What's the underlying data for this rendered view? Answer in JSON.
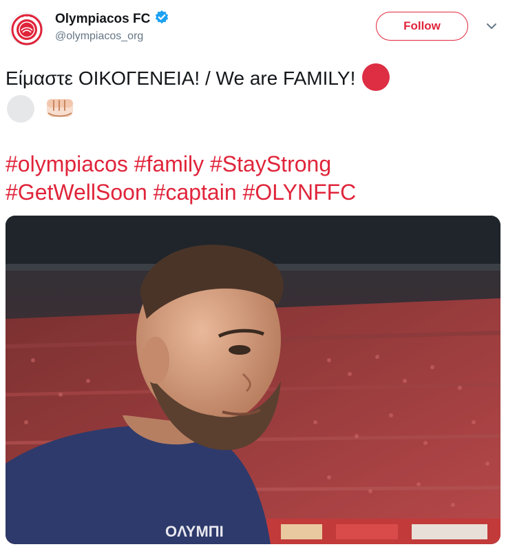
{
  "account": {
    "name": "Olympiacos FC",
    "handle": "@olympiacos_org",
    "avatar_icon": "olympiacos-crest",
    "verified_icon": "verified-badge-icon"
  },
  "follow_button": {
    "label": "Follow"
  },
  "more_icon": "chevron-down-icon",
  "tweet": {
    "line1": "Είμαστε ΟΙΚΟΓΕΝΕΙΑ! / We are FAMILY!",
    "emoji": [
      "red-circle",
      "white-circle",
      "fist"
    ]
  },
  "hashtags": {
    "line1": [
      "#olympiacos",
      "#family",
      "#StayStrong"
    ],
    "line2": [
      "#GetWellSoon",
      "#captain",
      "#OLYNFFC"
    ]
  },
  "media": {
    "description_icon": "photo",
    "shirt_text": "OΛΥΜΠΙ"
  },
  "colors": {
    "brand_red": "#e0243a",
    "verified_blue": "#1da1f2",
    "text": "#14171a",
    "muted": "#657786"
  }
}
